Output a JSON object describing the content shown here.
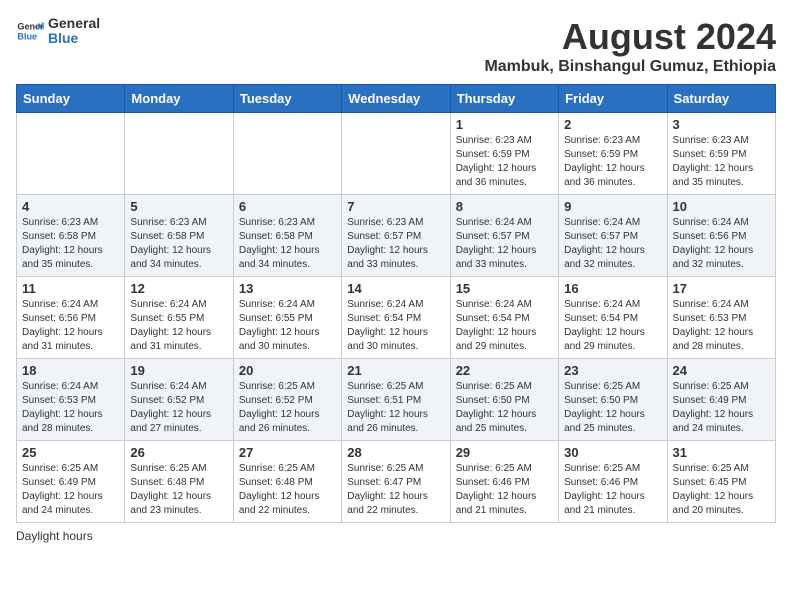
{
  "header": {
    "logo_general": "General",
    "logo_blue": "Blue",
    "main_title": "August 2024",
    "subtitle": "Mambuk, Binshangul Gumuz, Ethiopia"
  },
  "days_of_week": [
    "Sunday",
    "Monday",
    "Tuesday",
    "Wednesday",
    "Thursday",
    "Friday",
    "Saturday"
  ],
  "weeks": [
    [
      {
        "day": "",
        "info": ""
      },
      {
        "day": "",
        "info": ""
      },
      {
        "day": "",
        "info": ""
      },
      {
        "day": "",
        "info": ""
      },
      {
        "day": "1",
        "info": "Sunrise: 6:23 AM\nSunset: 6:59 PM\nDaylight: 12 hours and 36 minutes."
      },
      {
        "day": "2",
        "info": "Sunrise: 6:23 AM\nSunset: 6:59 PM\nDaylight: 12 hours and 36 minutes."
      },
      {
        "day": "3",
        "info": "Sunrise: 6:23 AM\nSunset: 6:59 PM\nDaylight: 12 hours and 35 minutes."
      }
    ],
    [
      {
        "day": "4",
        "info": "Sunrise: 6:23 AM\nSunset: 6:58 PM\nDaylight: 12 hours and 35 minutes."
      },
      {
        "day": "5",
        "info": "Sunrise: 6:23 AM\nSunset: 6:58 PM\nDaylight: 12 hours and 34 minutes."
      },
      {
        "day": "6",
        "info": "Sunrise: 6:23 AM\nSunset: 6:58 PM\nDaylight: 12 hours and 34 minutes."
      },
      {
        "day": "7",
        "info": "Sunrise: 6:23 AM\nSunset: 6:57 PM\nDaylight: 12 hours and 33 minutes."
      },
      {
        "day": "8",
        "info": "Sunrise: 6:24 AM\nSunset: 6:57 PM\nDaylight: 12 hours and 33 minutes."
      },
      {
        "day": "9",
        "info": "Sunrise: 6:24 AM\nSunset: 6:57 PM\nDaylight: 12 hours and 32 minutes."
      },
      {
        "day": "10",
        "info": "Sunrise: 6:24 AM\nSunset: 6:56 PM\nDaylight: 12 hours and 32 minutes."
      }
    ],
    [
      {
        "day": "11",
        "info": "Sunrise: 6:24 AM\nSunset: 6:56 PM\nDaylight: 12 hours and 31 minutes."
      },
      {
        "day": "12",
        "info": "Sunrise: 6:24 AM\nSunset: 6:55 PM\nDaylight: 12 hours and 31 minutes."
      },
      {
        "day": "13",
        "info": "Sunrise: 6:24 AM\nSunset: 6:55 PM\nDaylight: 12 hours and 30 minutes."
      },
      {
        "day": "14",
        "info": "Sunrise: 6:24 AM\nSunset: 6:54 PM\nDaylight: 12 hours and 30 minutes."
      },
      {
        "day": "15",
        "info": "Sunrise: 6:24 AM\nSunset: 6:54 PM\nDaylight: 12 hours and 29 minutes."
      },
      {
        "day": "16",
        "info": "Sunrise: 6:24 AM\nSunset: 6:54 PM\nDaylight: 12 hours and 29 minutes."
      },
      {
        "day": "17",
        "info": "Sunrise: 6:24 AM\nSunset: 6:53 PM\nDaylight: 12 hours and 28 minutes."
      }
    ],
    [
      {
        "day": "18",
        "info": "Sunrise: 6:24 AM\nSunset: 6:53 PM\nDaylight: 12 hours and 28 minutes."
      },
      {
        "day": "19",
        "info": "Sunrise: 6:24 AM\nSunset: 6:52 PM\nDaylight: 12 hours and 27 minutes."
      },
      {
        "day": "20",
        "info": "Sunrise: 6:25 AM\nSunset: 6:52 PM\nDaylight: 12 hours and 26 minutes."
      },
      {
        "day": "21",
        "info": "Sunrise: 6:25 AM\nSunset: 6:51 PM\nDaylight: 12 hours and 26 minutes."
      },
      {
        "day": "22",
        "info": "Sunrise: 6:25 AM\nSunset: 6:50 PM\nDaylight: 12 hours and 25 minutes."
      },
      {
        "day": "23",
        "info": "Sunrise: 6:25 AM\nSunset: 6:50 PM\nDaylight: 12 hours and 25 minutes."
      },
      {
        "day": "24",
        "info": "Sunrise: 6:25 AM\nSunset: 6:49 PM\nDaylight: 12 hours and 24 minutes."
      }
    ],
    [
      {
        "day": "25",
        "info": "Sunrise: 6:25 AM\nSunset: 6:49 PM\nDaylight: 12 hours and 24 minutes."
      },
      {
        "day": "26",
        "info": "Sunrise: 6:25 AM\nSunset: 6:48 PM\nDaylight: 12 hours and 23 minutes."
      },
      {
        "day": "27",
        "info": "Sunrise: 6:25 AM\nSunset: 6:48 PM\nDaylight: 12 hours and 22 minutes."
      },
      {
        "day": "28",
        "info": "Sunrise: 6:25 AM\nSunset: 6:47 PM\nDaylight: 12 hours and 22 minutes."
      },
      {
        "day": "29",
        "info": "Sunrise: 6:25 AM\nSunset: 6:46 PM\nDaylight: 12 hours and 21 minutes."
      },
      {
        "day": "30",
        "info": "Sunrise: 6:25 AM\nSunset: 6:46 PM\nDaylight: 12 hours and 21 minutes."
      },
      {
        "day": "31",
        "info": "Sunrise: 6:25 AM\nSunset: 6:45 PM\nDaylight: 12 hours and 20 minutes."
      }
    ]
  ],
  "footer": {
    "note": "Daylight hours"
  }
}
